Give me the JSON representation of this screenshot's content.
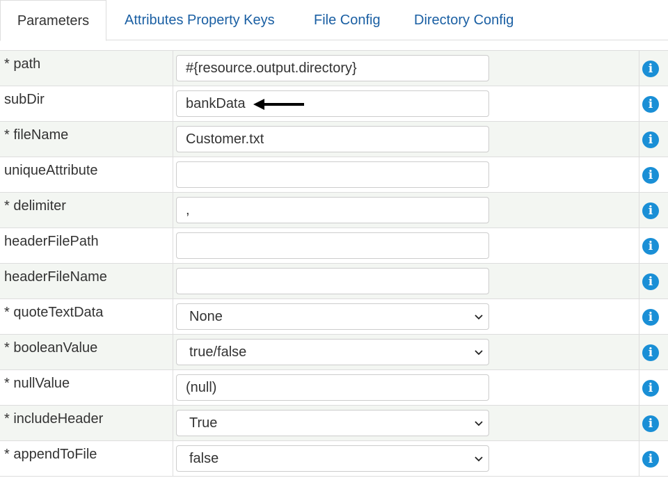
{
  "tabs": [
    {
      "label": "Parameters",
      "active": true
    },
    {
      "label": "Attributes Property Keys",
      "active": false
    },
    {
      "label": "File Config",
      "active": false
    },
    {
      "label": "Directory Config",
      "active": false
    }
  ],
  "rows": [
    {
      "label": "* path",
      "type": "text",
      "value": "#{resource.output.directory}"
    },
    {
      "label": "subDir",
      "type": "text",
      "value": "bankData"
    },
    {
      "label": "* fileName",
      "type": "text",
      "value": "Customer.txt"
    },
    {
      "label": "uniqueAttribute",
      "type": "text",
      "value": ""
    },
    {
      "label": "* delimiter",
      "type": "text",
      "value": ","
    },
    {
      "label": "headerFilePath",
      "type": "text",
      "value": ""
    },
    {
      "label": "headerFileName",
      "type": "text",
      "value": ""
    },
    {
      "label": "* quoteTextData",
      "type": "select",
      "value": "None"
    },
    {
      "label": "* booleanValue",
      "type": "select",
      "value": "true/false"
    },
    {
      "label": "* nullValue",
      "type": "text",
      "value": "(null)"
    },
    {
      "label": "* includeHeader",
      "type": "select",
      "value": "True"
    },
    {
      "label": "* appendToFile",
      "type": "select",
      "value": "false"
    }
  ],
  "icons": {
    "info": "info-circle-icon",
    "chevron": "chevron-down-icon",
    "arrow": "left-arrow-annotation"
  },
  "colors": {
    "link": "#1a5fa3",
    "info": "#1a8fd6",
    "row_shade": "#f3f6f2",
    "border": "#dddddd"
  }
}
